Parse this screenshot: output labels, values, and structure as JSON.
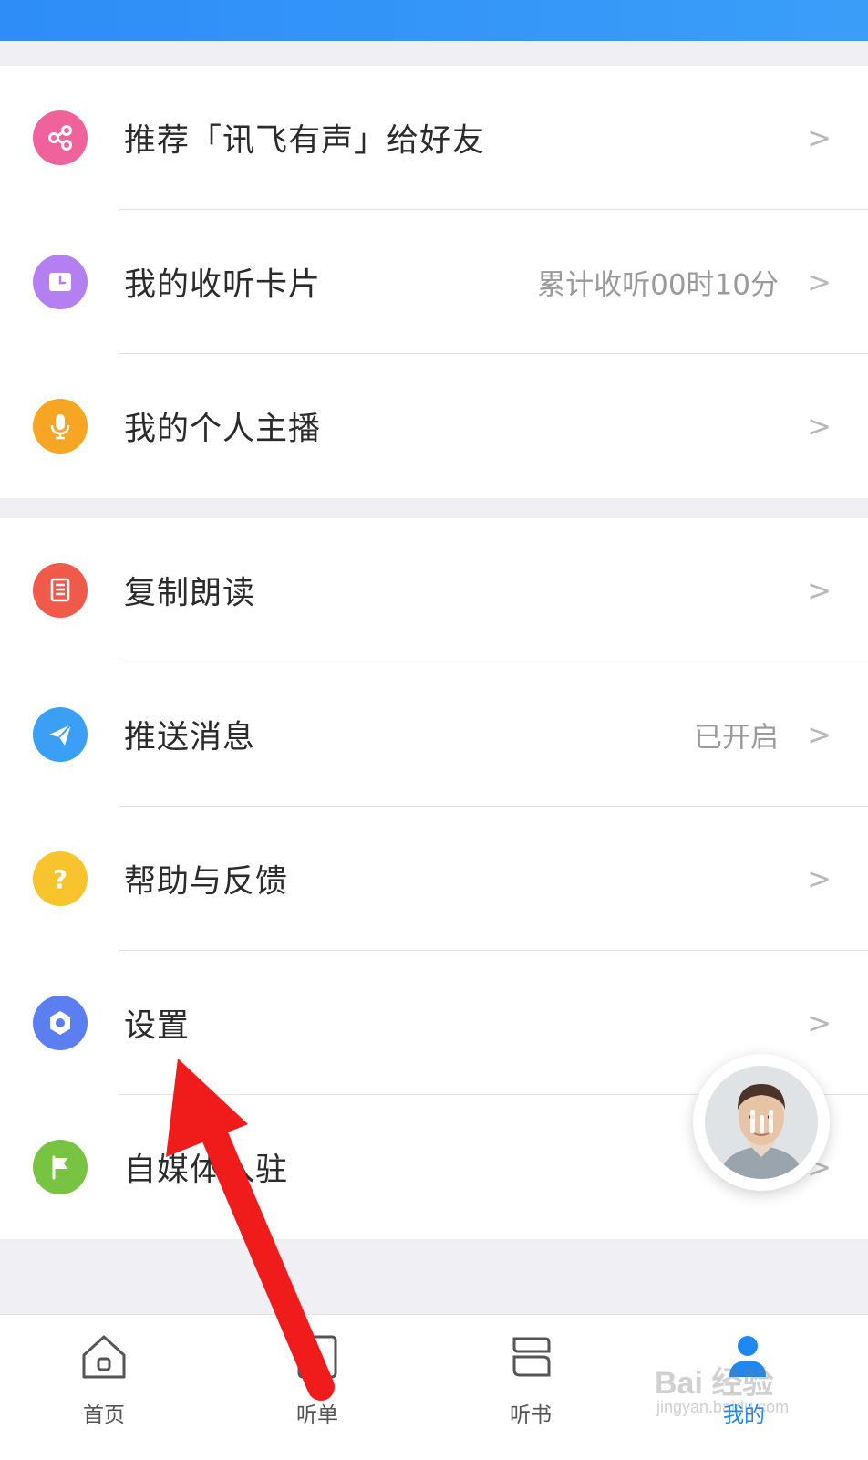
{
  "menu_group_1": [
    {
      "label": "推荐「讯飞有声」给好友",
      "value": "",
      "icon": "share-icon",
      "color": "#f0629c"
    },
    {
      "label": "我的收听卡片",
      "value": "累计收听00时10分",
      "icon": "clock-card-icon",
      "color": "#b47ff0"
    },
    {
      "label": "我的个人主播",
      "value": "",
      "icon": "microphone-icon",
      "color": "#f7a623"
    }
  ],
  "menu_group_2": [
    {
      "label": "复制朗读",
      "value": "",
      "icon": "document-icon",
      "color": "#ef5a4a"
    },
    {
      "label": "推送消息",
      "value": "已开启",
      "icon": "paper-plane-icon",
      "color": "#3a9ff5"
    },
    {
      "label": "帮助与反馈",
      "value": "",
      "icon": "question-icon",
      "color": "#f7c42d"
    },
    {
      "label": "设置",
      "value": "",
      "icon": "hexagon-settings-icon",
      "color": "#5b7ff0"
    },
    {
      "label": "自媒体入驻",
      "value": "",
      "icon": "flag-icon",
      "color": "#78c442"
    }
  ],
  "chevron": ">",
  "tabs": [
    {
      "label": "首页",
      "icon": "home-icon",
      "active": false
    },
    {
      "label": "听单",
      "icon": "playlist-icon",
      "active": false
    },
    {
      "label": "听书",
      "icon": "book-icon",
      "active": false
    },
    {
      "label": "我的",
      "icon": "user-icon",
      "active": true
    }
  ],
  "watermark": {
    "brand": "Bai  经验",
    "sub": "jingyan.baidu.com"
  },
  "colors": {
    "topbar": "#2e8df7",
    "active_tab": "#1e88f0",
    "annotation_arrow": "#f01b1b"
  }
}
